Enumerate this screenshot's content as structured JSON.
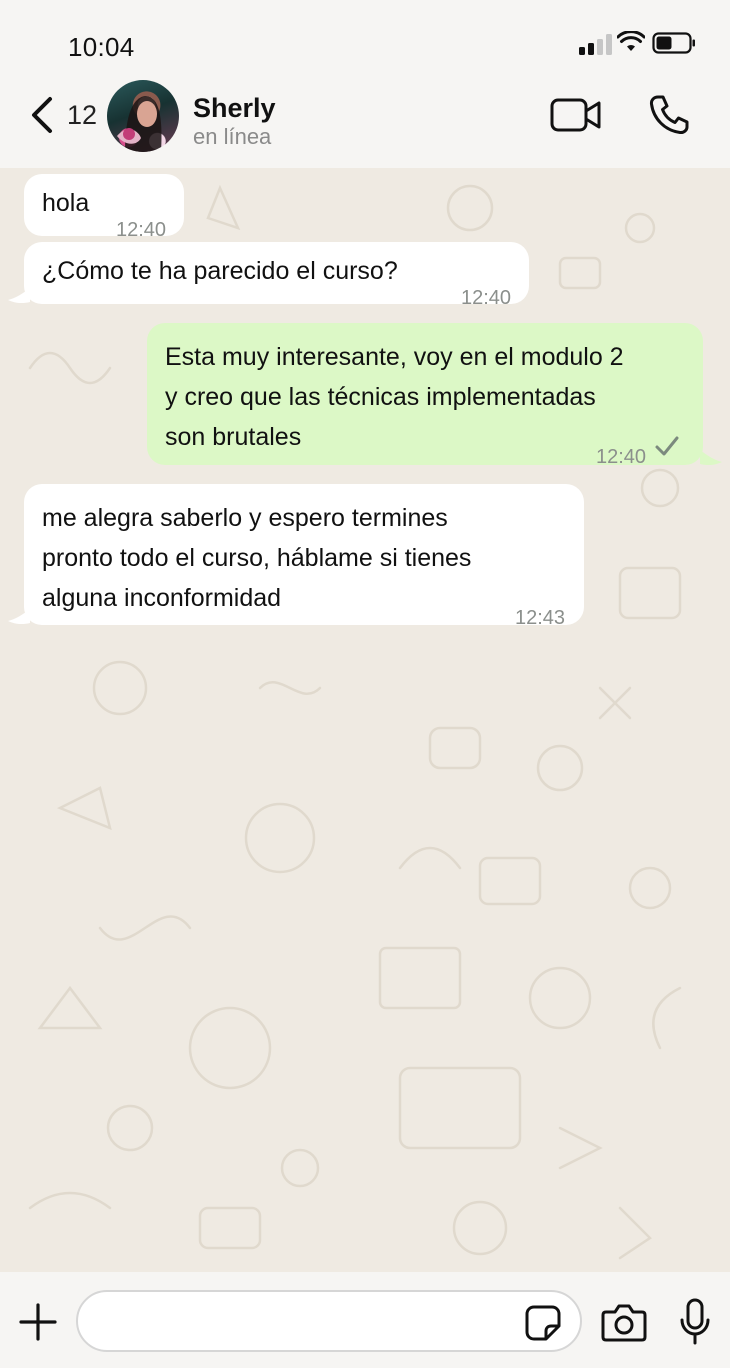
{
  "status_bar": {
    "time": "10:04"
  },
  "header": {
    "unread_count": "12",
    "contact_name": "Sherly",
    "contact_status": "en línea"
  },
  "messages": [
    {
      "direction": "incoming",
      "text": "hola",
      "time": "12:40"
    },
    {
      "direction": "incoming",
      "text": "¿Cómo te ha parecido el curso?",
      "time": "12:40"
    },
    {
      "direction": "outgoing",
      "lines": [
        "Esta muy interesante, voy en el modulo 2",
        "y creo que las técnicas implementadas",
        "son brutales"
      ],
      "time": "12:40",
      "status": "sent"
    },
    {
      "direction": "incoming",
      "lines": [
        "me alegra saberlo y espero termines",
        "pronto todo el curso, háblame si tienes",
        "alguna inconformidad"
      ],
      "time": "12:43"
    }
  ],
  "input": {
    "value": "",
    "placeholder": ""
  },
  "icons": {
    "back": "chevron-left-icon",
    "video": "video-camera-icon",
    "call": "phone-icon",
    "attach": "plus-icon",
    "sticker": "sticker-icon",
    "camera": "camera-icon",
    "mic": "microphone-icon",
    "read_receipt": "checkmark-icon"
  },
  "colors": {
    "incoming_bubble": "#ffffff",
    "outgoing_bubble": "#dcf8c6",
    "chat_background": "#efeae2",
    "bar_background": "#f6f5f3"
  }
}
